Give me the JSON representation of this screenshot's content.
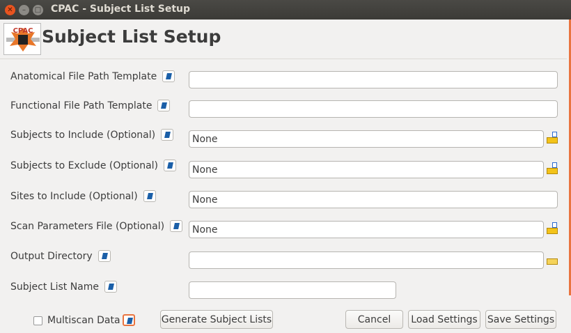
{
  "window": {
    "title": "CPAC - Subject List Setup"
  },
  "header": {
    "title": "Subject List Setup",
    "logo_text": "CPAC"
  },
  "fields": [
    {
      "label": "Anatomical File Path Template",
      "value": ""
    },
    {
      "label": "Functional File Path Template",
      "value": ""
    },
    {
      "label": "Subjects to Include (Optional)",
      "value": "None",
      "browse": "file-open-icon"
    },
    {
      "label": "Subjects to Exclude (Optional)",
      "value": "None",
      "browse": "file-open-icon"
    },
    {
      "label": "Sites to Include (Optional)",
      "value": "None"
    },
    {
      "label": "Scan Parameters File (Optional)",
      "value": "None",
      "browse": "file-open-icon"
    },
    {
      "label": "Output Directory",
      "value": "",
      "browse": "folder-icon"
    },
    {
      "label": "Subject List Name",
      "value": ""
    }
  ],
  "footer": {
    "multiscan_label": "Multiscan Data",
    "multiscan_checked": false,
    "generate": "Generate Subject Lists",
    "cancel": "Cancel",
    "load": "Load Settings",
    "save": "Save Settings"
  },
  "colors": {
    "accent": "#e9743f",
    "titlebar": "#3c3b37"
  }
}
